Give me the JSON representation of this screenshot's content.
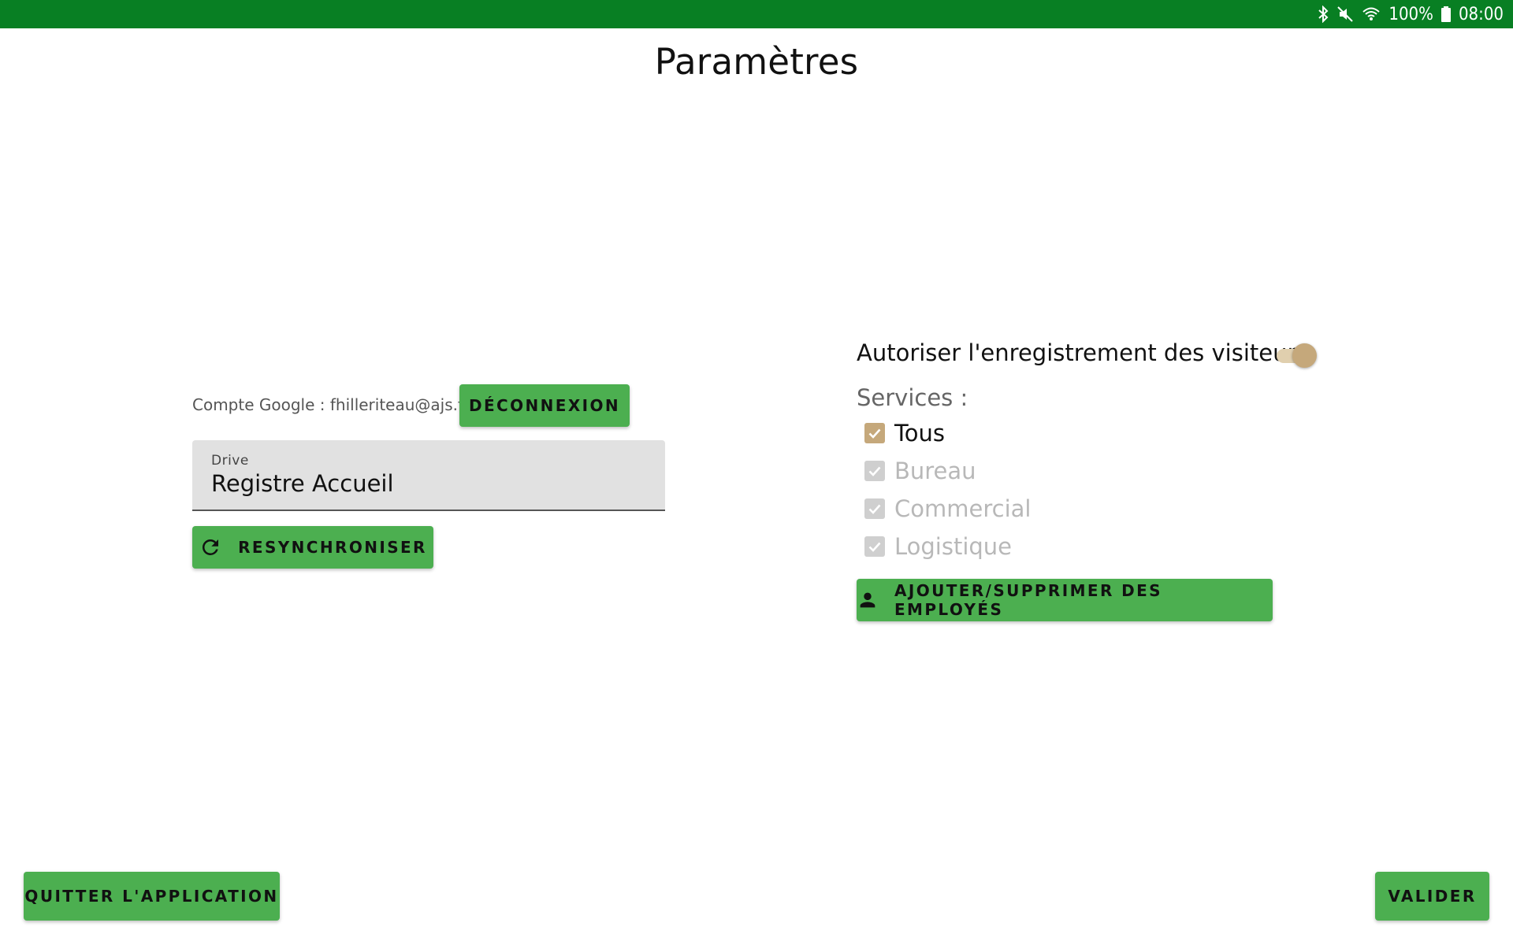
{
  "status_bar": {
    "battery_percent": "100%",
    "time": "08:00",
    "icons": [
      "bluetooth-icon",
      "mute-icon",
      "wifi-icon",
      "battery-icon"
    ],
    "color": "#087f23"
  },
  "page": {
    "title": "Paramètres"
  },
  "account": {
    "label": "Compte Google : fhilleriteau@ajs.fr",
    "logout_button": "DÉCONNEXION"
  },
  "drive_field": {
    "label": "Drive",
    "value": "Registre Accueil"
  },
  "resync_button": {
    "label": "RESYNCHRONISER",
    "icon": "refresh-icon"
  },
  "visitors": {
    "label": "Autoriser l'enregistrement des visiteurs",
    "enabled": true
  },
  "services": {
    "label": "Services :",
    "items": [
      {
        "label": "Tous",
        "checked": true,
        "disabled": false
      },
      {
        "label": "Bureau",
        "checked": true,
        "disabled": true
      },
      {
        "label": "Commercial",
        "checked": true,
        "disabled": true
      },
      {
        "label": "Logistique",
        "checked": true,
        "disabled": true
      }
    ]
  },
  "employees_button": {
    "label": "AJOUTER/SUPPRIMER DES EMPLOYÉS",
    "icon": "person-icon"
  },
  "footer": {
    "quit_button": "QUITTER L'APPLICATION",
    "validate_button": "VALIDER"
  },
  "colors": {
    "button_green": "#4caf50",
    "accent_tan": "#c5a87b"
  }
}
